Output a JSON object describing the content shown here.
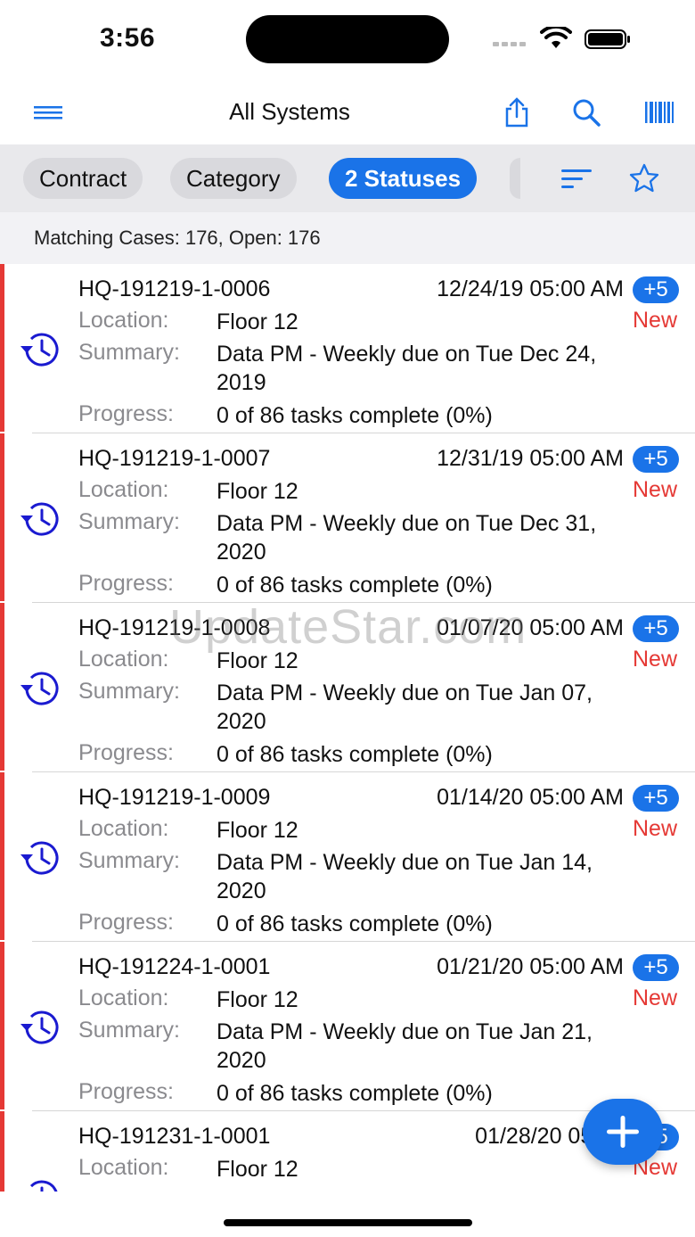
{
  "status_bar": {
    "time": "3:56"
  },
  "nav": {
    "title": "All Systems",
    "icons": [
      "menu-icon",
      "share-icon",
      "search-icon",
      "barcode-icon"
    ]
  },
  "filters": {
    "chips": [
      "Contract",
      "Category",
      "2 Statuses"
    ],
    "active_chip": "2 Statuses",
    "icons": [
      "sort-icon",
      "star-icon"
    ]
  },
  "summary": {
    "text": "Matching Cases: 176, Open: 176"
  },
  "labels": {
    "location": "Location:",
    "summary": "Summary:",
    "progress": "Progress:"
  },
  "cases": [
    {
      "id": "HQ-191219-1-0006",
      "date": "12/24/19 05:00 AM",
      "badge": "+5",
      "status": "New",
      "location": "Floor 12",
      "summary": "Data PM - Weekly due on Tue Dec 24, 2019",
      "progress": "0 of 86 tasks complete (0%)"
    },
    {
      "id": "HQ-191219-1-0007",
      "date": "12/31/19 05:00 AM",
      "badge": "+5",
      "status": "New",
      "location": "Floor 12",
      "summary": "Data PM - Weekly due on Tue Dec 31, 2020",
      "progress": "0 of 86 tasks complete (0%)"
    },
    {
      "id": "HQ-191219-1-0008",
      "date": "01/07/20 05:00 AM",
      "badge": "+5",
      "status": "New",
      "location": "Floor 12",
      "summary": "Data PM - Weekly due on Tue Jan 07, 2020",
      "progress": "0 of 86 tasks complete (0%)"
    },
    {
      "id": "HQ-191219-1-0009",
      "date": "01/14/20 05:00 AM",
      "badge": "+5",
      "status": "New",
      "location": "Floor 12",
      "summary": "Data PM - Weekly due on Tue Jan 14, 2020",
      "progress": "0 of 86 tasks complete (0%)"
    },
    {
      "id": "HQ-191224-1-0001",
      "date": "01/21/20 05:00 AM",
      "badge": "+5",
      "status": "New",
      "location": "Floor 12",
      "summary": "Data PM - Weekly due on Tue Jan 21, 2020",
      "progress": "0 of 86 tasks complete (0%)"
    },
    {
      "id": "HQ-191231-1-0001",
      "date": "01/28/20 05:00",
      "badge": "+5",
      "status": "New",
      "location": "Floor 12",
      "summary": "",
      "progress": ""
    }
  ],
  "fab": {
    "icon": "plus-icon"
  },
  "watermark": "UpdateStar.com",
  "colors": {
    "accent": "#1a73e8",
    "status_new": "#e53935",
    "label_gray": "#8a8a8e"
  }
}
